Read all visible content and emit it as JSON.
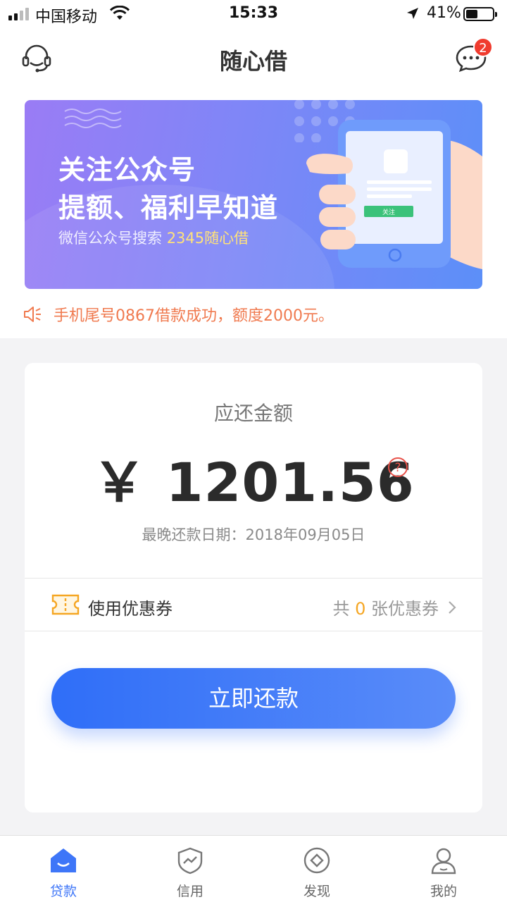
{
  "status_bar": {
    "carrier": "中国移动",
    "time": "15:33",
    "battery": "41%"
  },
  "header": {
    "title": "随心借",
    "message_badge": "2"
  },
  "banner": {
    "title_line1": "关注公众号",
    "title_line2": "提额、福利早知道",
    "subtitle_prefix": "微信公众号搜索 ",
    "subtitle_highlight": "2345随心借",
    "phone_button": "关注"
  },
  "notice": {
    "text": "手机尾号0867借款成功，额度2000元。"
  },
  "repayment": {
    "label": "应还金额",
    "amount": "￥ 1201.56",
    "due_date": "最晚还款日期：2018年09月05日"
  },
  "coupon": {
    "label": "使用优惠券",
    "count_prefix": "共 ",
    "count": "0",
    "count_suffix": " 张优惠券"
  },
  "pay_button": "立即还款",
  "tabs": [
    {
      "label": "贷款",
      "icon": "home-icon",
      "active": true
    },
    {
      "label": "信用",
      "icon": "shield-chart-icon",
      "active": false
    },
    {
      "label": "发现",
      "icon": "compass-icon",
      "active": false
    },
    {
      "label": "我的",
      "icon": "user-icon",
      "active": false
    }
  ],
  "colors": {
    "accent": "#3e76f8",
    "notice": "#f07a4f",
    "coupon_count": "#f5a623",
    "badge": "#f03b2e"
  }
}
